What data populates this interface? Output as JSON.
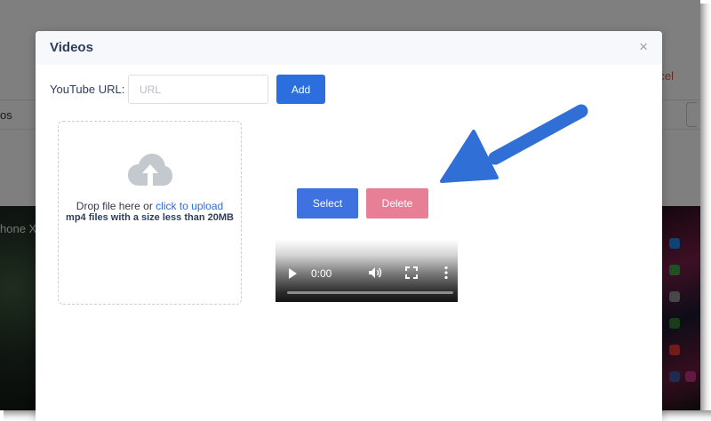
{
  "background": {
    "cancel_partial": "cel",
    "tab_partial": "os",
    "video_title_partial": "hone X"
  },
  "modal": {
    "title": "Videos",
    "close_glyph": "×",
    "youtube_label": "YouTube URL:",
    "url_placeholder": "URL",
    "url_value": "",
    "add_label": "Add"
  },
  "dropzone": {
    "text_prefix": "Drop file here or ",
    "link_text": "click to upload",
    "hint": "mp4 files with a size less than 20MB",
    "icon": "cloud-upload-icon"
  },
  "actions": {
    "select_label": "Select",
    "delete_label": "Delete"
  },
  "video": {
    "time": "0:00",
    "progress": 0
  },
  "colors": {
    "primary": "#2b6ee0",
    "select": "#3f72e0",
    "delete": "#e77f97",
    "title": "#2d3e5c",
    "arrow": "#2f6fd6"
  }
}
